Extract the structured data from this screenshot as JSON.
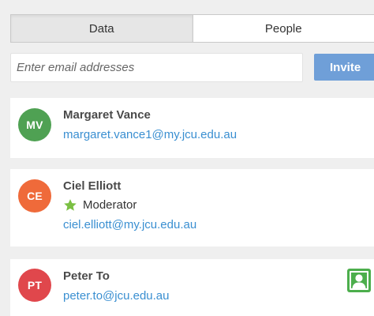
{
  "tabs": [
    {
      "label": "Data",
      "active": true
    },
    {
      "label": "People",
      "active": false
    }
  ],
  "invite": {
    "placeholder": "Enter email addresses",
    "value": "",
    "button_label": "Invite",
    "button_color": "#6f9fd8"
  },
  "people": [
    {
      "initials": "MV",
      "name": "Margaret Vance",
      "email": "margaret.vance1@my.jcu.edu.au",
      "avatar_color": "#4fa153"
    },
    {
      "initials": "CE",
      "name": "Ciel Elliott",
      "role": "Moderator",
      "role_icon": "star-icon",
      "email": "ciel.elliott@my.jcu.edu.au",
      "avatar_color": "#ef6a3a"
    },
    {
      "initials": "PT",
      "name": "Peter To",
      "email": "peter.to@jcu.edu.au",
      "avatar_color": "#e0474c",
      "badge_icon": "person-badge-icon"
    }
  ],
  "colors": {
    "link": "#3a8fd1",
    "star": "#7bc043",
    "badge": "#4cae4c"
  }
}
